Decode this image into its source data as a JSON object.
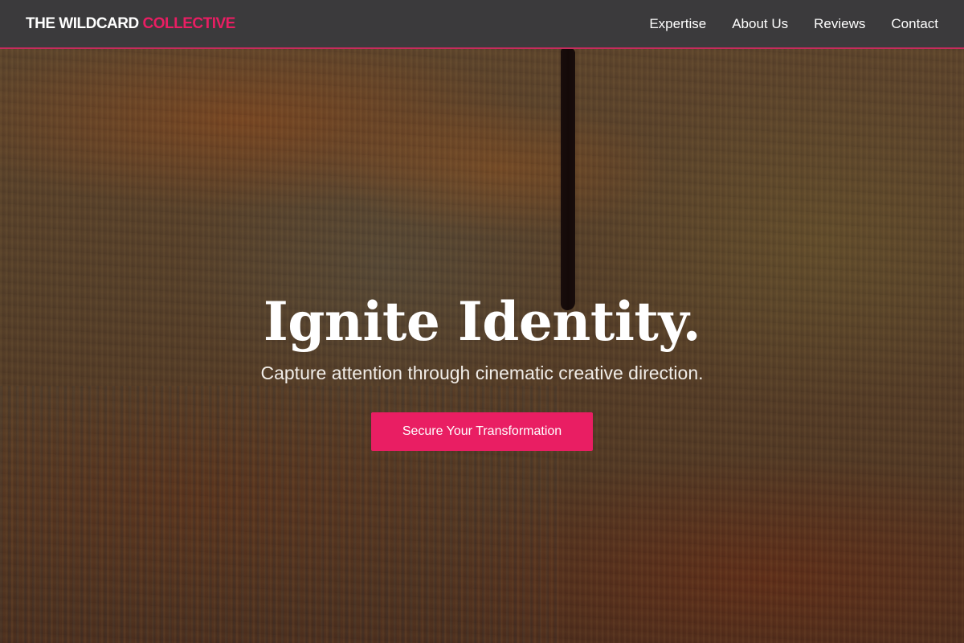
{
  "navbar": {
    "brand_main": "THE WILDCARD",
    "brand_accent": "COLLECTIVE",
    "links": [
      {
        "label": "Expertise"
      },
      {
        "label": "About Us"
      },
      {
        "label": "Reviews"
      },
      {
        "label": "Contact"
      }
    ]
  },
  "hero": {
    "title": "Ignite Identity.",
    "subtitle": "Capture attention through cinematic creative direction.",
    "cta_label": "Secure Your Transformation"
  },
  "colors": {
    "accent": "#e91e63",
    "navbar_bg": "#3b3a3c",
    "text": "#ffffff"
  }
}
